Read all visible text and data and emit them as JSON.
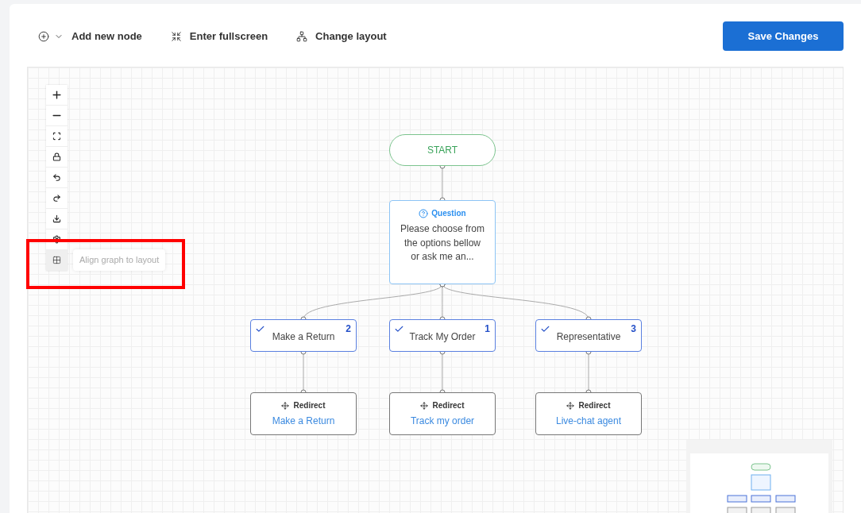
{
  "toolbar": {
    "items": [
      {
        "kind": "add",
        "label": "Add new node"
      },
      {
        "kind": "fullscreen",
        "label": "Enter fullscreen"
      },
      {
        "kind": "layout",
        "label": "Change layout"
      }
    ],
    "save_button": "Save Changes"
  },
  "controls": [
    {
      "kind": "zoom_in",
      "hovered": false
    },
    {
      "kind": "zoom_out",
      "hovered": false
    },
    {
      "kind": "fit",
      "hovered": false
    },
    {
      "kind": "lock",
      "hovered": false
    },
    {
      "kind": "undo",
      "hovered": false
    },
    {
      "kind": "redo",
      "hovered": false
    },
    {
      "kind": "download",
      "hovered": false
    },
    {
      "kind": "settings",
      "hovered": false
    },
    {
      "kind": "align",
      "hovered": true,
      "tooltip": "Align graph to layout"
    }
  ],
  "flow": {
    "start": {
      "label": "START"
    },
    "question": {
      "type": "Question",
      "text": "Please choose from the options bellow or ask me an..."
    },
    "options": [
      {
        "label": "Make a Return",
        "number": "2",
        "checked": true
      },
      {
        "label": "Track My Order",
        "number": "1",
        "checked": true
      },
      {
        "label": "Representative",
        "number": "3",
        "checked": true
      }
    ],
    "redirects": [
      {
        "type": "Redirect",
        "target": "Make a Return"
      },
      {
        "type": "Redirect",
        "target": "Track my order"
      },
      {
        "type": "Redirect",
        "target": "Live-chat agent"
      }
    ]
  }
}
